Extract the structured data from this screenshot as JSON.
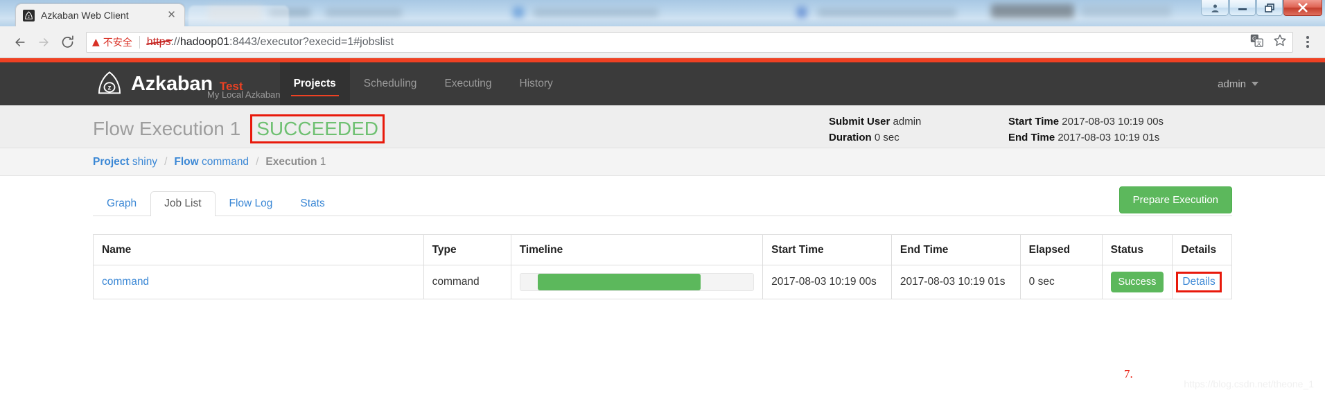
{
  "browser": {
    "tab_title": "Azkaban Web Client",
    "tab_close_glyph": "✕",
    "security_label": "不安全",
    "warning_glyph": "▲",
    "url_scheme": "https",
    "url_sep": "://",
    "url_host": "hadoop01",
    "url_rest": ":8443/executor?execid=1#jobslist",
    "back_glyph": "←",
    "forward_glyph": "→",
    "reload_glyph": "⟳",
    "translate_glyph": "文A",
    "bookmark_glyph": "☆",
    "win_user_glyph": "☻",
    "win_minimize_glyph": "—",
    "win_maximize_glyph": "❐",
    "win_close_glyph": "✕"
  },
  "navbar": {
    "brand_name": "Azkaban",
    "brand_tag": "Test",
    "brand_subtitle": "My Local Azkaban",
    "links": [
      {
        "label": "Projects",
        "active": true
      },
      {
        "label": "Scheduling",
        "active": false
      },
      {
        "label": "Executing",
        "active": false
      },
      {
        "label": "History",
        "active": false
      }
    ],
    "user": "admin"
  },
  "execution_header": {
    "title": "Flow Execution 1",
    "status": "SUCCEEDED",
    "submit_user_label": "Submit User",
    "submit_user_value": "admin",
    "duration_label": "Duration",
    "duration_value": "0 sec",
    "start_time_label": "Start Time",
    "start_time_value": "2017-08-03 10:19 00s",
    "end_time_label": "End Time",
    "end_time_value": "2017-08-03 10:19 01s"
  },
  "breadcrumb": {
    "project_label": "Project",
    "project_value": "shiny",
    "flow_label": "Flow",
    "flow_value": "command",
    "execution_label": "Execution",
    "execution_value": "1",
    "separator": "/"
  },
  "tabs": [
    {
      "label": "Graph",
      "active": false
    },
    {
      "label": "Job List",
      "active": true
    },
    {
      "label": "Flow Log",
      "active": false
    },
    {
      "label": "Stats",
      "active": false
    }
  ],
  "prepare_button": "Prepare Execution",
  "joblist": {
    "columns": [
      "Name",
      "Type",
      "Timeline",
      "Start Time",
      "End Time",
      "Elapsed",
      "Status",
      "Details"
    ],
    "rows": [
      {
        "name": "command",
        "type": "command",
        "timeline_start_pct": 7.5,
        "timeline_width_pct": 70,
        "start_time": "2017-08-03 10:19 00s",
        "end_time": "2017-08-03 10:19 01s",
        "elapsed": "0 sec",
        "status": "Success",
        "details": "Details"
      }
    ]
  },
  "annotations": {
    "step_number": "7.",
    "watermark": "https://blog.csdn.net/theone_1"
  },
  "colors": {
    "brand_red": "#ef4123",
    "success_green": "#5cb85c",
    "status_text_green": "#6ec071",
    "annotation_red": "#e8190b",
    "link_blue": "#3a87d5",
    "navbar_dark": "#3b3b3b"
  }
}
